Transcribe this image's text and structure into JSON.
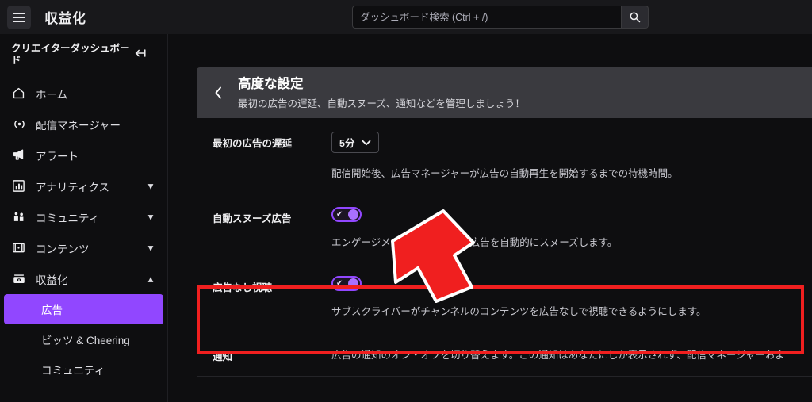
{
  "topbar": {
    "menu_icon": "hamburger-icon",
    "title": "収益化",
    "search_placeholder": "ダッシュボード検索 (Ctrl + /)",
    "search_value": "",
    "search_icon": "search-icon"
  },
  "sidebar": {
    "header_title": "クリエイターダッシュボード",
    "collapse_icon": "collapse-left-icon",
    "items": [
      {
        "label": "ホーム",
        "icon": "home-icon",
        "chevron": ""
      },
      {
        "label": "配信マネージャー",
        "icon": "broadcast-icon",
        "chevron": ""
      },
      {
        "label": "アラート",
        "icon": "megaphone-icon",
        "chevron": ""
      },
      {
        "label": "アナリティクス",
        "icon": "chart-icon",
        "chevron": "▾"
      },
      {
        "label": "コミュニティ",
        "icon": "community-icon",
        "chevron": "▾"
      },
      {
        "label": "コンテンツ",
        "icon": "content-icon",
        "chevron": "▾"
      },
      {
        "label": "収益化",
        "icon": "monetization-icon",
        "chevron": "▴"
      }
    ],
    "sub_items": [
      {
        "label": "広告",
        "active": true
      },
      {
        "label": "ビッツ & Cheering",
        "active": false
      },
      {
        "label": "コミュニティ",
        "active": false
      }
    ]
  },
  "panel": {
    "back_icon": "chevron-left-icon",
    "title": "高度な設定",
    "subtitle": "最初の広告の遅延、自動スヌーズ、通知などを管理しましょう！",
    "rows": [
      {
        "label": "最初の広告の遅延",
        "control": "select",
        "value": "5分",
        "chevron_icon": "chevron-down-icon",
        "description": "配信開始後、広告マネージャーが広告の自動再生を開始するまでの待機時間。"
      },
      {
        "label": "自動スヌーズ広告",
        "control": "toggle",
        "toggle_on": true,
        "description": "エンゲージメントが高いときは広告を自動的にスヌーズします。"
      },
      {
        "label": "広告なし視聴",
        "control": "toggle",
        "toggle_on": true,
        "description": "サブスクライバーがチャンネルのコンテンツを広告なしで視聴できるようにします。"
      },
      {
        "label": "通知",
        "control": "none",
        "description": "広告の通知のオン・オフを切り替えます。この通知はあなたにしか表示されず、配信マネージャーおよ"
      }
    ]
  },
  "annotations": {
    "highlight_color": "#f01f1f",
    "arrow_color": "#f01f1f",
    "arrow_outline": "#ffffff",
    "arrow_target": "広告なし視聴"
  },
  "colors": {
    "accent": "#9147ff",
    "background": "#0e0e10",
    "topbar": "#18181b",
    "panel_header": "#3a3a3f"
  }
}
